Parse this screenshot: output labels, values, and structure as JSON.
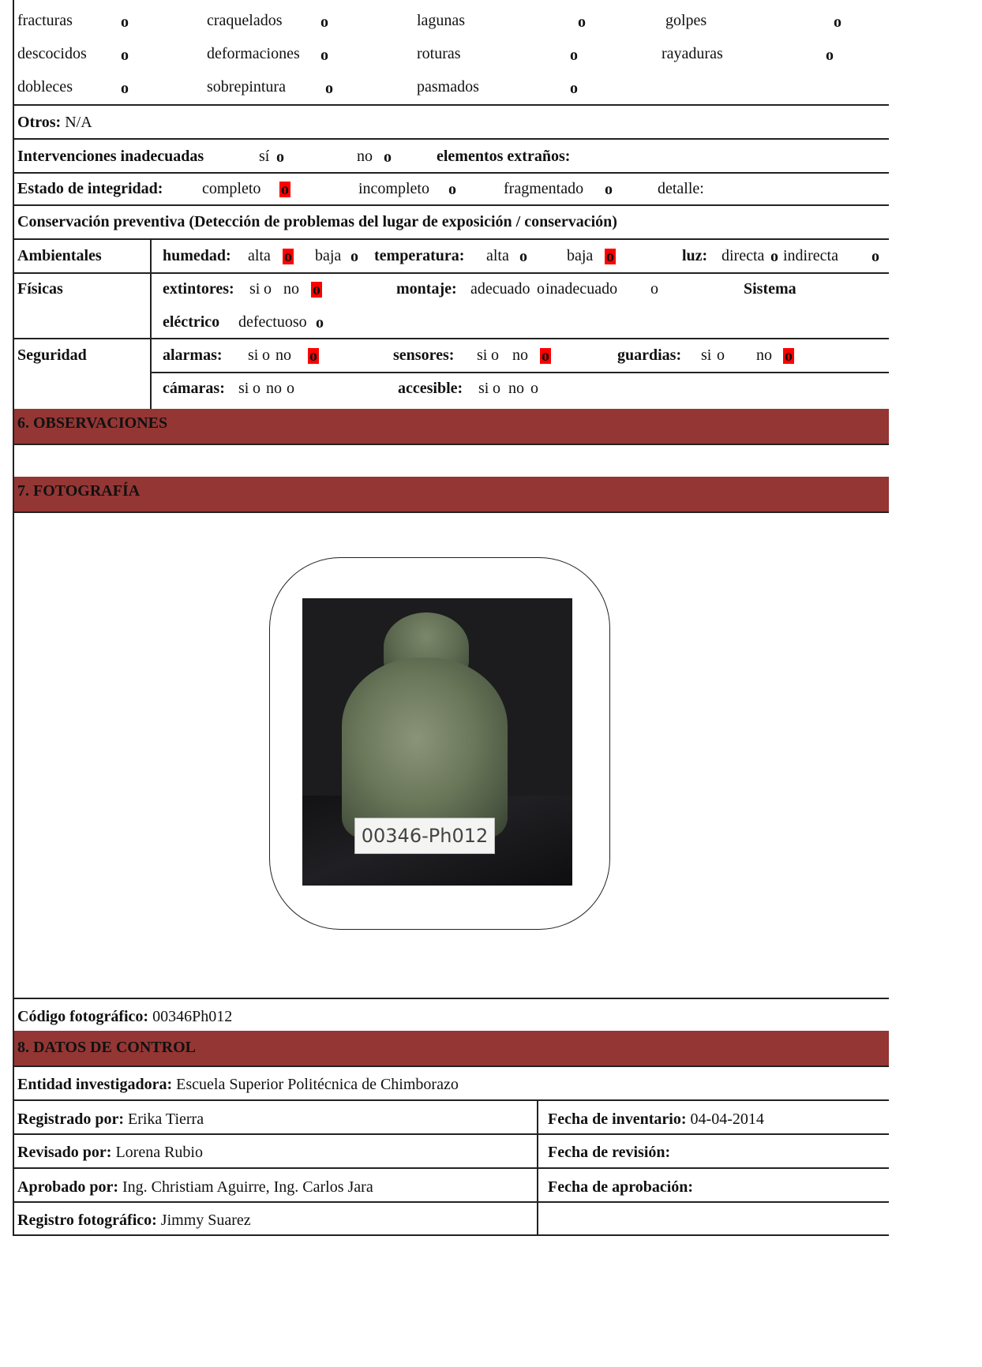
{
  "damage_rows": [
    [
      {
        "label": "fracturas",
        "mark": "o"
      },
      {
        "label": "craquelados",
        "mark": "o"
      },
      {
        "label": "lagunas",
        "mark": "o"
      },
      {
        "label": "golpes",
        "mark": "o"
      }
    ],
    [
      {
        "label": "descocidos",
        "mark": "o"
      },
      {
        "label": "deformaciones",
        "mark": "o"
      },
      {
        "label": "roturas",
        "mark": "o"
      },
      {
        "label": "rayaduras",
        "mark": "o"
      }
    ],
    [
      {
        "label": "dobleces",
        "mark": "o"
      },
      {
        "label": "sobrepintura",
        "mark": "o"
      },
      {
        "label": "pasmados",
        "mark": "o"
      }
    ]
  ],
  "otros": {
    "label": "Otros:",
    "value": "N/A"
  },
  "intervenciones": {
    "label": "Intervenciones inadecuadas",
    "si": "sí",
    "no": "no",
    "mark": "o",
    "extranos": "elementos extraños:"
  },
  "integridad": {
    "label": "Estado de integridad:",
    "completo": "completo",
    "incompleto": "incompleto",
    "fragmentado": "fragmentado",
    "detalle": "detalle:",
    "mark": "o"
  },
  "conservacion_title": "Conservación preventiva (Detección de problemas del lugar de exposición / conservación)",
  "ambientales": {
    "label": "Ambientales",
    "humedad": "humedad:",
    "alta": "alta",
    "baja": "baja",
    "temperatura": "temperatura:",
    "luz": "luz:",
    "directa": "directa",
    "indirecta": "indirecta",
    "mark": "o"
  },
  "fisicas": {
    "label": "Físicas",
    "extintores": "extintores:",
    "si": "si",
    "no": "no",
    "montaje": "montaje:",
    "adecuado": "adecuado",
    "inadecuado": "inadecuado",
    "sistema": "Sistema",
    "electrico": "eléctrico",
    "defectuoso": "defectuoso",
    "mark": "o"
  },
  "seguridad": {
    "label": "Seguridad",
    "alarmas": "alarmas:",
    "sensores": "sensores:",
    "guardias": "guardias:",
    "camaras": "cámaras:",
    "accesible": "accesible:",
    "si": "si",
    "no": "no",
    "mark": "o"
  },
  "sec6": "6. OBSERVACIONES",
  "sec7": "7. FOTOGRAFÍA",
  "photo_tag": "00346-Ph012",
  "codigo": {
    "label": "Código fotográfico:",
    "value": "00346Ph012"
  },
  "sec8": "8. DATOS DE CONTROL",
  "entidad": {
    "label": "Entidad investigadora:",
    "value": "Escuela Superior Politécnica de Chimborazo"
  },
  "registrado": {
    "label": "Registrado por:",
    "value": "Erika Tierra"
  },
  "fecha_inv": {
    "label": "Fecha de inventario:",
    "value": "04-04-2014"
  },
  "revisado": {
    "label": "Revisado por:",
    "value": "Lorena Rubio"
  },
  "fecha_rev": {
    "label": "Fecha de revisión:"
  },
  "aprobado": {
    "label": "Aprobado por:",
    "value": "Ing. Christiam Aguirre, Ing. Carlos Jara"
  },
  "fecha_apr": {
    "label": "Fecha de aprobación:"
  },
  "registro_foto": {
    "label": "Registro fotográfico:",
    "value": "Jimmy Suarez"
  },
  "colors": {
    "section_band": "#943634",
    "checked_mark": "#ff0000"
  }
}
